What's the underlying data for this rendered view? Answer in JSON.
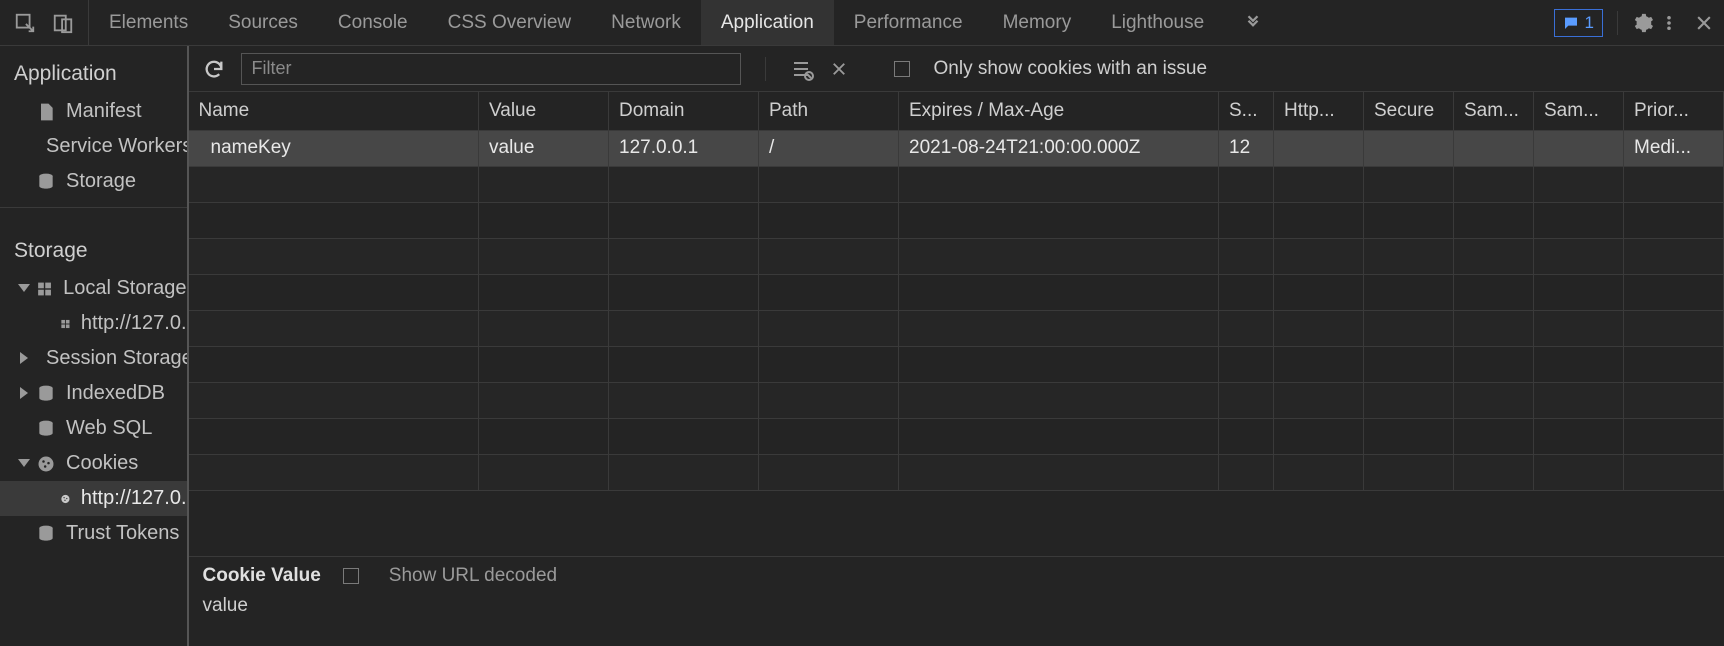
{
  "tabs": {
    "elements": "Elements",
    "sources": "Sources",
    "console": "Console",
    "css_overview": "CSS Overview",
    "network": "Network",
    "application": "Application",
    "performance": "Performance",
    "memory": "Memory",
    "lighthouse": "Lighthouse"
  },
  "issues_count": "1",
  "sidebar": {
    "application": {
      "title": "Application",
      "manifest": "Manifest",
      "service_workers": "Service Workers",
      "storage": "Storage"
    },
    "storage": {
      "title": "Storage",
      "local_storage": "Local Storage",
      "local_storage_child": "http://127.0.",
      "session_storage": "Session Storage",
      "indexeddb": "IndexedDB",
      "web_sql": "Web SQL",
      "cookies": "Cookies",
      "cookies_child": "http://127.0.",
      "trust_tokens": "Trust Tokens"
    }
  },
  "toolbar": {
    "filter_placeholder": "Filter",
    "only_issues": "Only show cookies with an issue"
  },
  "table": {
    "headers": {
      "name": "Name",
      "value": "Value",
      "domain": "Domain",
      "path": "Path",
      "expires": "Expires / Max-Age",
      "size": "S...",
      "httponly": "Http...",
      "secure": "Secure",
      "samesite": "Sam...",
      "sameparty": "Sam...",
      "priority": "Prior..."
    },
    "rows": [
      {
        "name": "nameKey",
        "value": "value",
        "domain": "127.0.0.1",
        "path": "/",
        "expires": "2021-08-24T21:00:00.000Z",
        "size": "12",
        "httponly": "",
        "secure": "",
        "samesite": "",
        "sameparty": "",
        "priority": "Medi..."
      }
    ]
  },
  "detail": {
    "title": "Cookie Value",
    "url_decoded": "Show URL decoded",
    "value": "value"
  }
}
